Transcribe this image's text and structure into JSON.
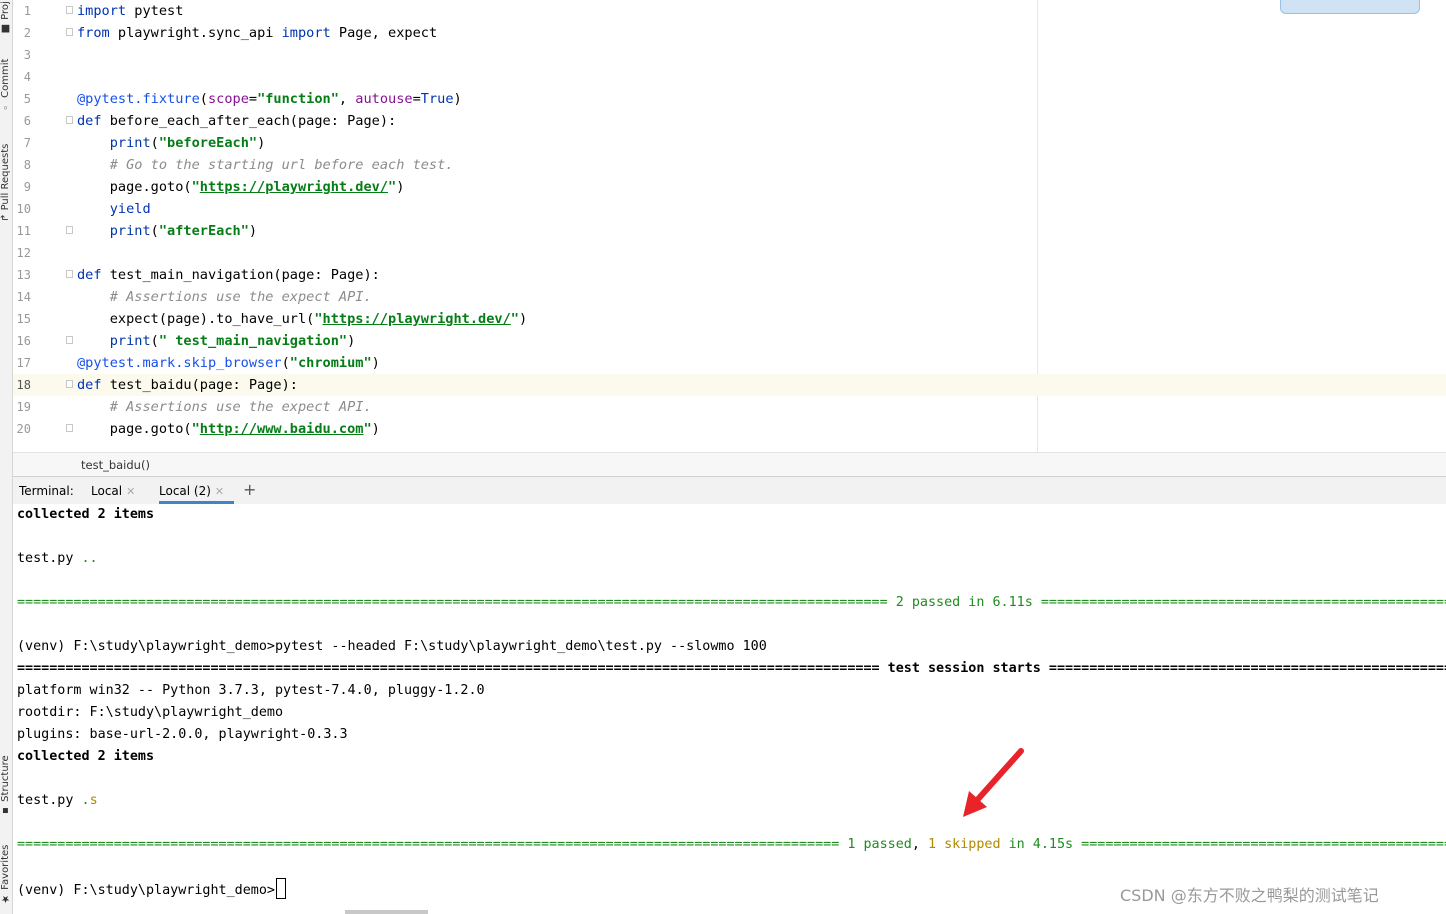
{
  "side_tabs": {
    "project": "Proj",
    "commit": "Commit",
    "pull_requests": "Pull Requests",
    "structure": "Structure",
    "favorites": "Favorites"
  },
  "editor": {
    "lines": [
      {
        "n": "1",
        "html": "<span class=\"kw\">import</span> pytest"
      },
      {
        "n": "2",
        "html": "<span class=\"kw\">from</span> playwright.sync_api <span class=\"kw\">import</span> Page, expect"
      },
      {
        "n": "3",
        "html": ""
      },
      {
        "n": "4",
        "html": ""
      },
      {
        "n": "5",
        "html": "<span class=\"dec\">@pytest.fixture</span>(<span class=\"param\">scope</span>=<span class=\"str\">\"function\"</span>, <span class=\"param\">autouse</span>=<span class=\"kw\">True</span>)"
      },
      {
        "n": "6",
        "html": "<span class=\"kw\">def</span> before_each_after_each(page: Page):"
      },
      {
        "n": "7",
        "html": "    <span class=\"bi\">print</span>(<span class=\"str\">\"beforeEach\"</span>)"
      },
      {
        "n": "8",
        "html": "    <span class=\"com\"># Go to the starting url before each test.</span>"
      },
      {
        "n": "9",
        "html": "    page.goto(<span class=\"str\">\"</span><span class=\"url\">https://playwright.dev/</span><span class=\"str\">\"</span>)"
      },
      {
        "n": "10",
        "html": "    <span class=\"kw\">yield</span>"
      },
      {
        "n": "11",
        "html": "    <span class=\"bi\">print</span>(<span class=\"str\">\"afterEach\"</span>)"
      },
      {
        "n": "12",
        "html": ""
      },
      {
        "n": "13",
        "html": "<span class=\"kw\">def</span> test_main_navigation(page: Page):"
      },
      {
        "n": "14",
        "html": "    <span class=\"com\"># Assertions use the expect API.</span>"
      },
      {
        "n": "15",
        "html": "    expect(page).to_have_url(<span class=\"str\">\"</span><span class=\"url\">https://playwright.dev/</span><span class=\"str\">\"</span>)"
      },
      {
        "n": "16",
        "html": "    <span class=\"bi\">print</span>(<span class=\"str\">\" test_main_navigation\"</span>)"
      },
      {
        "n": "17",
        "html": "<span class=\"dec\">@pytest.mark.skip_browser</span>(<span class=\"str\">\"chromium\"</span>)"
      },
      {
        "n": "18",
        "html": "<span class=\"kw\">def</span> test_baidu(page: Page):",
        "current": true
      },
      {
        "n": "19",
        "html": "    <span class=\"com\"># Assertions use the expect API.</span>"
      },
      {
        "n": "20",
        "html": "    page.goto(<span class=\"str\">\"</span><span class=\"url\">http://www.baidu.com</span><span class=\"str\">\"</span>)"
      }
    ]
  },
  "breadcrumb": "test_baidu()",
  "terminal": {
    "label": "Terminal:",
    "tabs": [
      "Local",
      "Local (2)"
    ],
    "add": "+",
    "prompt_path": "(venv) F:\\study\\playwright_demo>",
    "lines": [
      {
        "html": "<span class=\"b\">collected 2 items</span>"
      },
      {
        "html": ""
      },
      {
        "html": "test.py <span class=\"g\">..</span>"
      },
      {
        "html": ""
      },
      {
        "html": "<span class=\"g\">============================================================================================================ 2 passed in 6.11s ============================================================================================================</span>"
      },
      {
        "html": ""
      },
      {
        "html": "(venv) F:\\study\\playwright_demo>pytest --headed F:\\study\\playwright_demo\\test.py --slowmo 100"
      },
      {
        "html": "<span class=\"b\">=========================================================================================================== test session starts ===========================================================================================================</span>"
      },
      {
        "html": "platform win32 -- Python 3.7.3, pytest-7.4.0, pluggy-1.2.0"
      },
      {
        "html": "rootdir: F:\\study\\playwright_demo"
      },
      {
        "html": "plugins: base-url-2.0.0, playwright-0.3.3"
      },
      {
        "html": "<span class=\"b\">collected 2 items</span>"
      },
      {
        "html": ""
      },
      {
        "html": "test.py <span class=\"g\">.</span><span class=\"y\">s</span>"
      },
      {
        "html": ""
      },
      {
        "html": "<span class=\"g\">====================================================================================================== 1 passed</span>, <span class=\"y\">1 skipped</span> <span class=\"g\">in 4.15s ======================================================================================================</span>"
      },
      {
        "html": ""
      }
    ]
  },
  "watermark": "CSDN @东方不败之鸭梨的测试笔记",
  "colors": {
    "arrow": "#e8232a",
    "accent": "#4083c9"
  }
}
